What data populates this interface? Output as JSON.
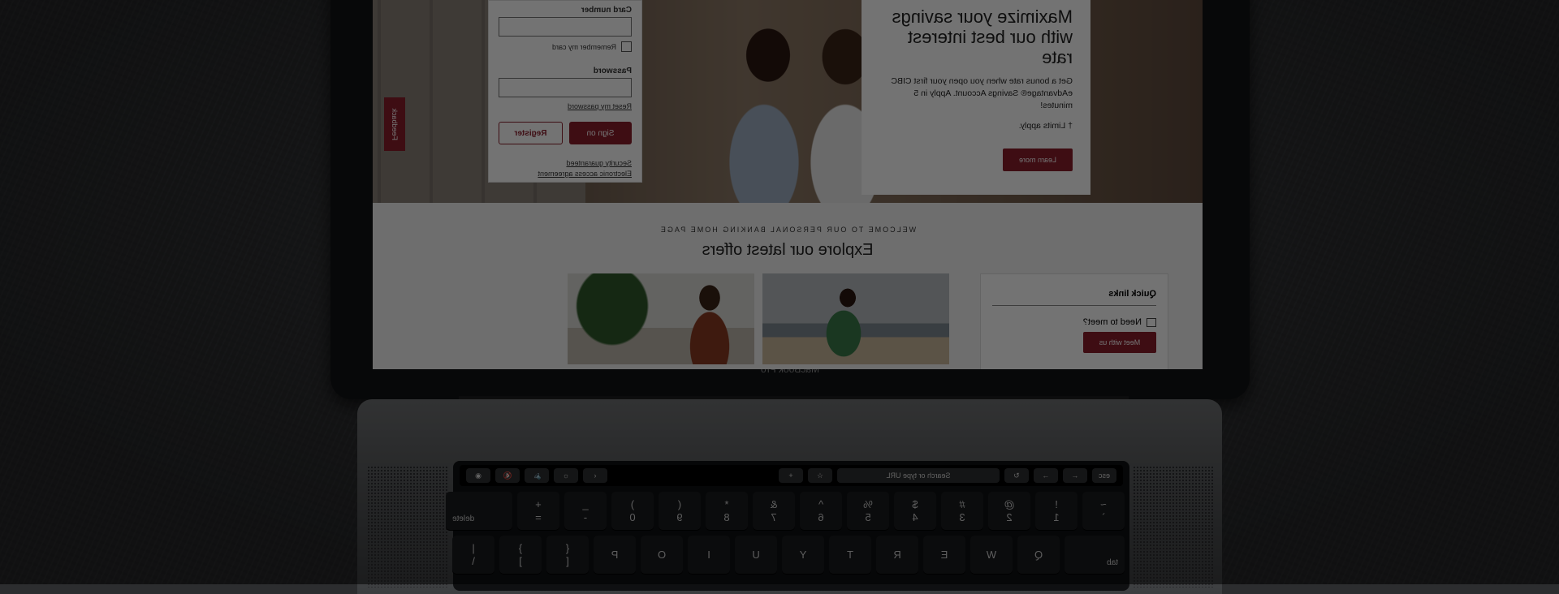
{
  "laptop": {
    "model_label": "MacBook Pro"
  },
  "website": {
    "signin": {
      "card_number_label": "Card number",
      "remember_label": "Remember my card",
      "password_label": "Password",
      "reset_link": "Reset my password",
      "signon_button": "Sign on",
      "register_button": "Register",
      "security_link": "Security guaranteed",
      "agreement_link": "Electronic access agreement"
    },
    "promo": {
      "headline": "Maximize your savings with our best interest rate",
      "body": "Get a bonus rate when you open your first CIBC eAdvantage® Savings Account. Apply in 5 minutes!",
      "note": "† Limits apply.",
      "button": "Learn more"
    },
    "feedback_tab": "Feedback",
    "eyebrow": "WELCOME TO OUR PERSONAL BANKING HOME PAGE",
    "headline": "Explore our latest offers",
    "quick_links": {
      "title": "Quick links",
      "item": "Need to meet?",
      "button": "Meet with us"
    },
    "brand_color": "#8b1d2c"
  },
  "touchbar": {
    "esc": "esc",
    "back": "←",
    "forward": "→",
    "reload": "↻",
    "url_placeholder": "Search or type URL",
    "bookmark": "☆",
    "add": "+",
    "chevron": "‹",
    "brightness": "☼",
    "volume": "🔈",
    "mute": "🔇",
    "siri": "◉"
  },
  "keyboard": {
    "row1": [
      {
        "top": "~",
        "bottom": "`"
      },
      {
        "top": "!",
        "bottom": "1"
      },
      {
        "top": "@",
        "bottom": "2"
      },
      {
        "top": "#",
        "bottom": "3"
      },
      {
        "top": "$",
        "bottom": "4"
      },
      {
        "top": "%",
        "bottom": "5"
      },
      {
        "top": "^",
        "bottom": "6"
      },
      {
        "top": "&",
        "bottom": "7"
      },
      {
        "top": "*",
        "bottom": "8"
      },
      {
        "top": "(",
        "bottom": "9"
      },
      {
        "top": ")",
        "bottom": "0"
      },
      {
        "top": "_",
        "bottom": "-"
      },
      {
        "top": "+",
        "bottom": "="
      }
    ],
    "delete": "delete",
    "tab": "tab",
    "row2": [
      "Q",
      "W",
      "E",
      "R",
      "T",
      "Y",
      "U",
      "I",
      "O",
      "P"
    ],
    "row2_brackets": [
      {
        "top": "{",
        "bottom": "["
      },
      {
        "top": "}",
        "bottom": "]"
      },
      {
        "top": "|",
        "bottom": "\\"
      }
    ]
  }
}
